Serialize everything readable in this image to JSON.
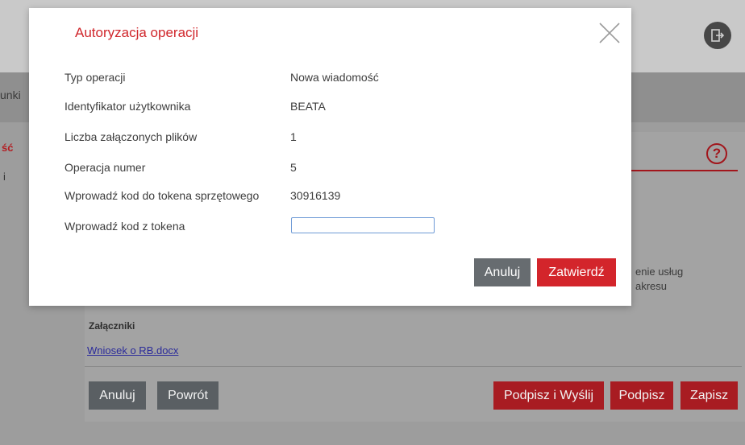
{
  "background": {
    "nav_fragment": "unki",
    "side_fragment_active": "ść",
    "side_fragment_other": "i",
    "help_icon_text": "?",
    "text_line1": "enie usług",
    "text_line2": "akresu",
    "attachments_title": "Załączniki",
    "attachment_link": "Wniosek o RB.docx",
    "buttons": {
      "cancel": "Anuluj",
      "back": "Powrót",
      "sign_send": "Podpisz i Wyślij",
      "sign": "Podpisz",
      "save": "Zapisz"
    }
  },
  "modal": {
    "title": "Autoryzacja operacji",
    "rows": [
      {
        "label": "Typ operacji",
        "value": "Nowa wiadomość"
      },
      {
        "label": "Identyfikator użytkownika",
        "value": "BEATA"
      },
      {
        "label": "Liczba załączonych plików",
        "value": "1"
      },
      {
        "label": "Operacja numer",
        "value": "5"
      },
      {
        "label": "Wprowadź kod do tokena sprzętowego",
        "value": "30916139"
      }
    ],
    "token_label": "Wprowadź kod z tokena",
    "token_value": "",
    "cancel_label": "Anuluj",
    "confirm_label": "Zatwierdź"
  },
  "colors": {
    "accent_red": "#d3252b",
    "button_grey": "#676c70"
  }
}
